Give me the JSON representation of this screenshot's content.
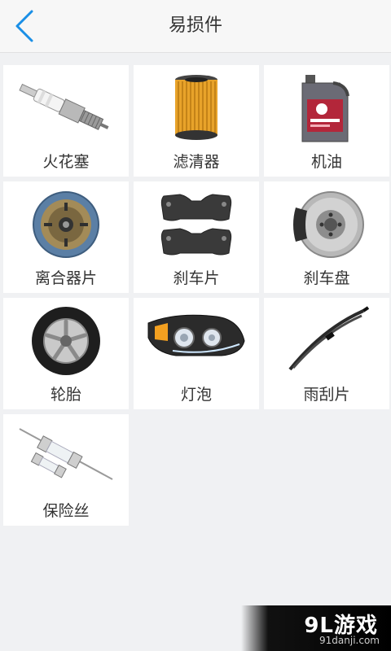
{
  "header": {
    "title": "易损件"
  },
  "items": [
    {
      "label": "火花塞",
      "icon": "spark-plug-icon"
    },
    {
      "label": "滤清器",
      "icon": "filter-icon"
    },
    {
      "label": "机油",
      "icon": "engine-oil-icon"
    },
    {
      "label": "离合器片",
      "icon": "clutch-disc-icon"
    },
    {
      "label": "刹车片",
      "icon": "brake-pad-icon"
    },
    {
      "label": "刹车盘",
      "icon": "brake-disc-icon"
    },
    {
      "label": "轮胎",
      "icon": "tire-icon"
    },
    {
      "label": "灯泡",
      "icon": "headlight-icon"
    },
    {
      "label": "雨刮片",
      "icon": "wiper-blade-icon"
    },
    {
      "label": "保险丝",
      "icon": "fuse-icon"
    }
  ],
  "watermark": {
    "brand": "9L游戏",
    "url": "91danji.com"
  },
  "colors": {
    "accent": "#1a8fe6",
    "background": "#f0f1f3",
    "tile": "#ffffff"
  }
}
